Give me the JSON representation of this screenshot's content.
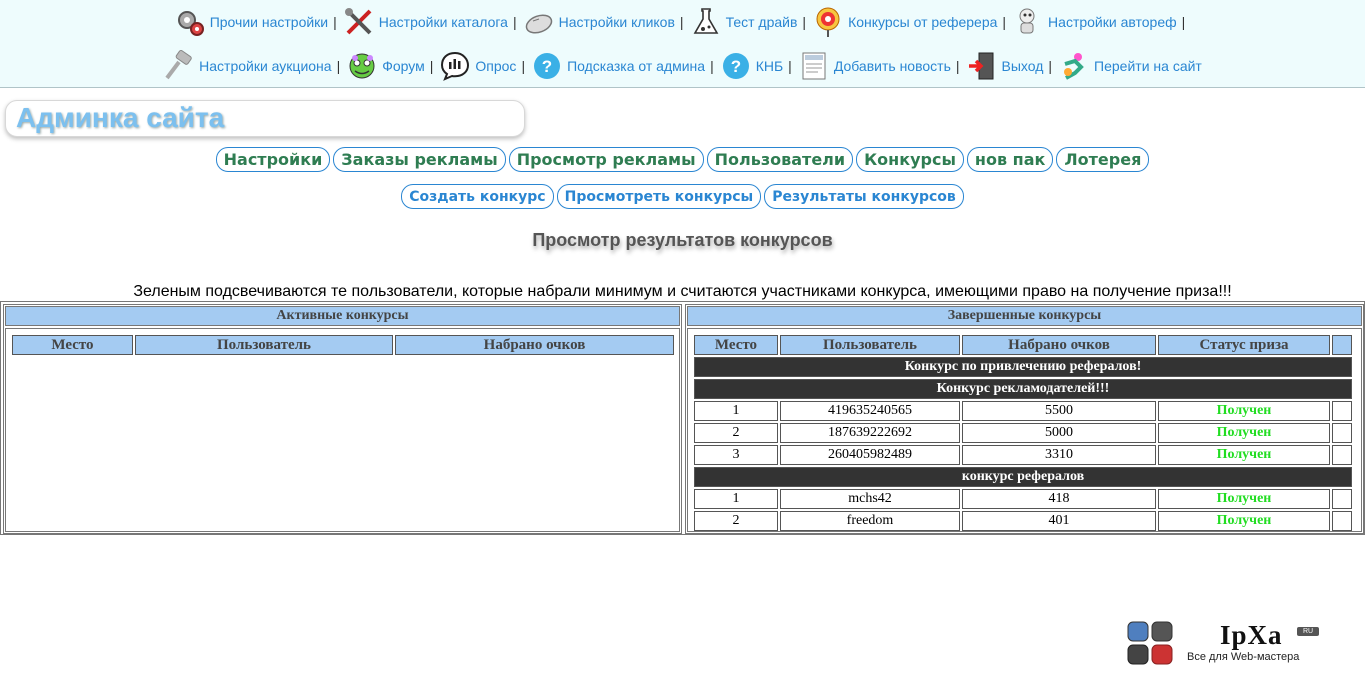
{
  "nav": {
    "row1": [
      {
        "label": "Прочии настройки",
        "icon": "gears-icon"
      },
      {
        "label": "Настройки каталога",
        "icon": "tools-icon"
      },
      {
        "label": "Настройки кликов",
        "icon": "mouse-icon"
      },
      {
        "label": "Тест драйв",
        "icon": "flask-icon"
      },
      {
        "label": "Конкурсы от реферера",
        "icon": "target-icon"
      },
      {
        "label": "Настройки автореф",
        "icon": "robot-icon"
      }
    ],
    "row2": [
      {
        "label": "Настройки аукциона",
        "icon": "gavel-icon"
      },
      {
        "label": "Форум",
        "icon": "forum-icon"
      },
      {
        "label": "Опрос",
        "icon": "poll-icon"
      },
      {
        "label": "Подсказка от админа",
        "icon": "help-icon"
      },
      {
        "label": "КНБ",
        "icon": "help-icon"
      },
      {
        "label": "Добавить новость",
        "icon": "news-icon"
      },
      {
        "label": "Выход",
        "icon": "exit-icon"
      },
      {
        "label": "Перейти на сайт",
        "icon": "runner-icon"
      }
    ],
    "separator": "|"
  },
  "site_title": "Админка сайта",
  "main_menu": [
    "Настройки",
    "Заказы рекламы",
    "Просмотр рекламы",
    "Пользователи",
    "Конкурсы",
    "нов пак",
    "Лотерея"
  ],
  "sub_menu": [
    "Создать конкурс",
    "Просмотреть конкурсы",
    "Результаты конкурсов"
  ],
  "page_heading": "Просмотр результатов конкурсов",
  "notice": "Зеленым подсвечиваются те пользователи, которые набрали минимум и считаются участниками конкурса, имеющими право на получение приза!!!",
  "active": {
    "title": "Активные конкурсы",
    "columns": [
      "Место",
      "Пользователь",
      "Набрано очков"
    ]
  },
  "finished": {
    "title": "Завершенные конкурсы",
    "columns": [
      "Место",
      "Пользователь",
      "Набрано очков",
      "Статус приза",
      ""
    ],
    "groups": [
      {
        "name": "Конкурс по привлечению рефералов!",
        "rows": []
      },
      {
        "name": "Конкурс рекламодателей!!!",
        "rows": [
          {
            "place": "1",
            "user": "419635240565",
            "points": "5500",
            "status": "Получен"
          },
          {
            "place": "2",
            "user": "187639222692",
            "points": "5000",
            "status": "Получен"
          },
          {
            "place": "3",
            "user": "260405982489",
            "points": "3310",
            "status": "Получен"
          }
        ]
      },
      {
        "name": "конкурс рефералов",
        "rows": [
          {
            "place": "1",
            "user": "mchs42",
            "points": "418",
            "status": "Получен"
          },
          {
            "place": "2",
            "user": "freedom",
            "points": "401",
            "status": "Получен"
          }
        ]
      }
    ]
  },
  "logo": {
    "name": "IpXa",
    "badge": "RU",
    "tagline": "Все для Web-мастера"
  },
  "colors": {
    "link": "#2a86d2",
    "menu_green": "#2f7d52",
    "header_blue": "#a4cbf2",
    "status_green": "#22dd22",
    "group_dark": "#333333",
    "topbar_bg": "#eefcfd"
  }
}
